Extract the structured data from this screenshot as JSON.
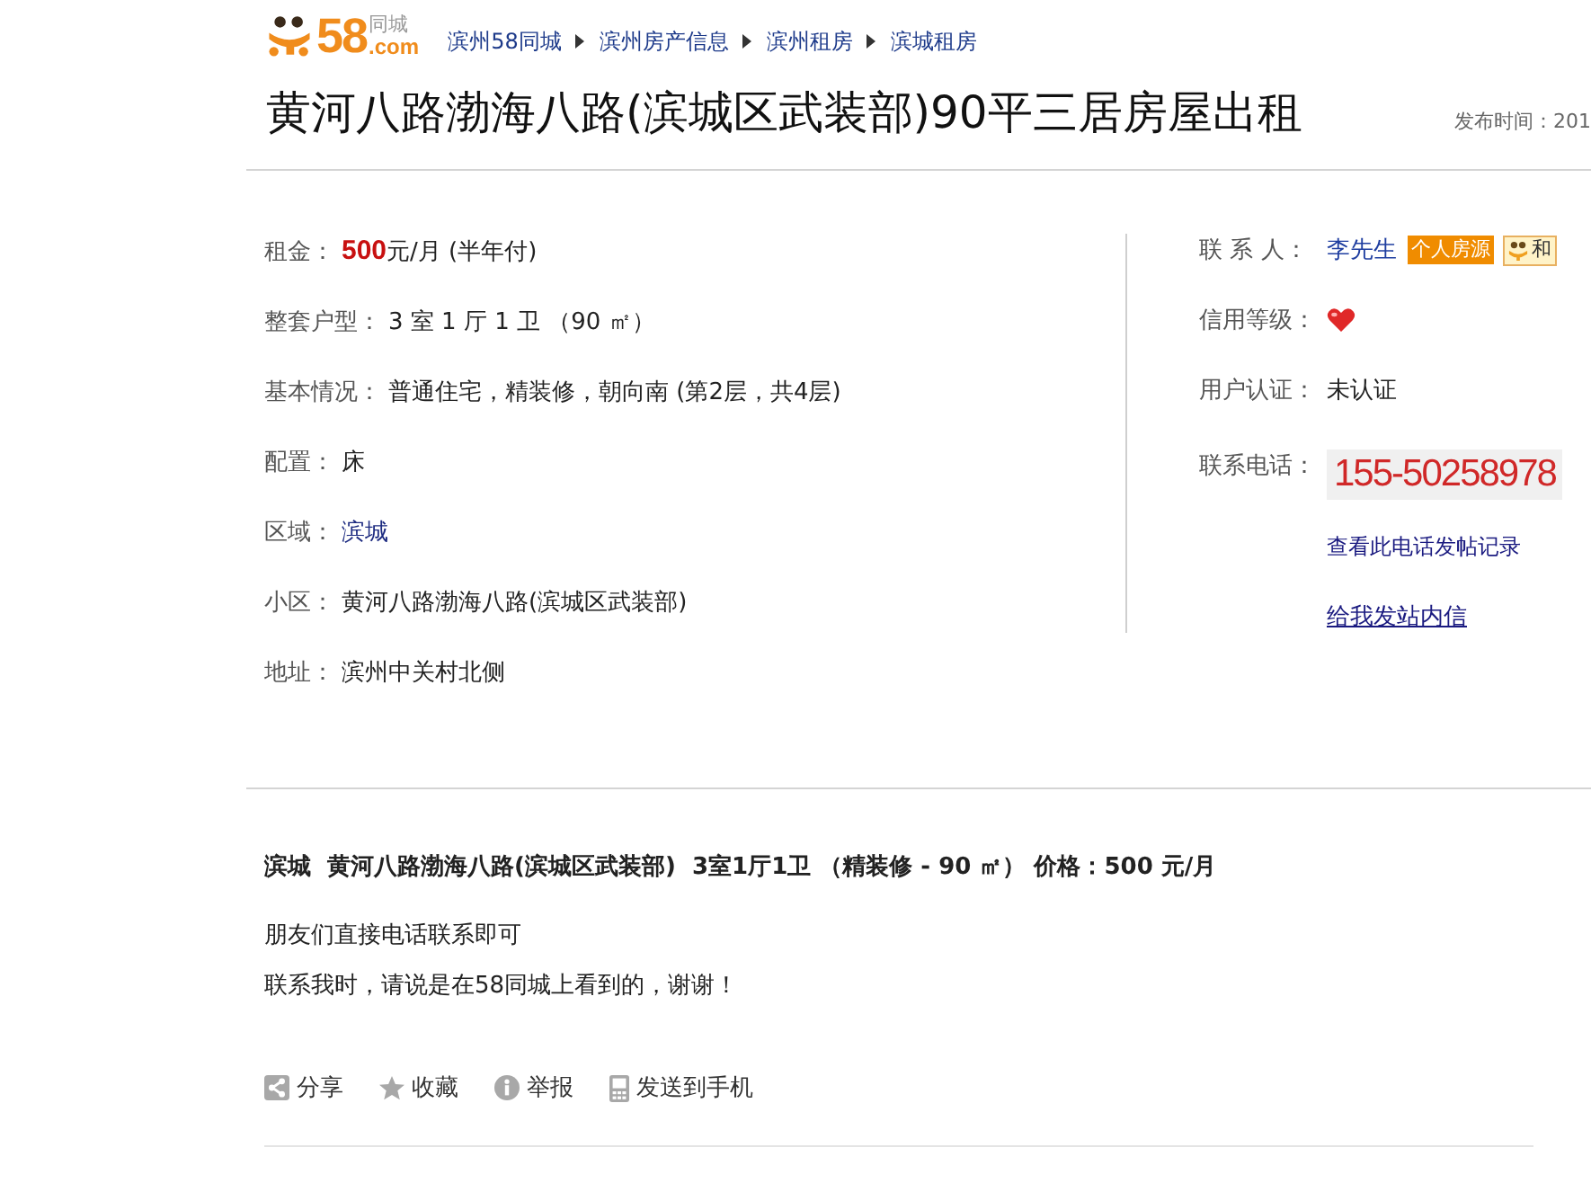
{
  "header": {
    "logo": {
      "number": "58",
      "domain": ".com",
      "city": "同城"
    },
    "breadcrumb": [
      {
        "label": "滨州58同城"
      },
      {
        "label": "滨州房产信息"
      },
      {
        "label": "滨州租房"
      },
      {
        "label": "滨城租房"
      }
    ]
  },
  "listing": {
    "title": "黄河八路渤海八路(滨城区武装部)90平三居房屋出租",
    "publish_time": "发布时间：201"
  },
  "details": [
    {
      "kind": "price",
      "label": "租金：",
      "amount": "500",
      "value": "元/月 (半年付)"
    },
    {
      "kind": "text",
      "label": "整套户型：",
      "value": "3 室 1 厅 1 卫 （90 ㎡）"
    },
    {
      "kind": "text",
      "label": "基本情况：",
      "value": "普通住宅，精装修，朝向南 (第2层，共4层)"
    },
    {
      "kind": "text",
      "label": "配置：",
      "value": "床"
    },
    {
      "kind": "link",
      "label": "区域：",
      "value": "滨城"
    },
    {
      "kind": "text",
      "label": "小区：",
      "value": "黄河八路渤海八路(滨城区武装部)"
    },
    {
      "kind": "text",
      "label": "地址：",
      "value": "滨州中关村北侧"
    }
  ],
  "contact": {
    "person": {
      "label": "联 系 人：",
      "name": "李先生",
      "badges": [
        {
          "kind": "personal",
          "label": "个人房源"
        },
        {
          "kind": "partner",
          "label": "和"
        }
      ]
    },
    "credit": {
      "label": "信用等级："
    },
    "verification": {
      "label": "用户认证：",
      "value": "未认证"
    },
    "phone": {
      "label": "联系电话：",
      "number": "155-50258978"
    },
    "links": [
      {
        "label": "查看此电话发帖记录",
        "underlined": false
      },
      {
        "label": "给我发站内信",
        "underlined": true
      }
    ]
  },
  "summary": "滨城  黄河八路渤海八路(滨城区武装部)  3室1厅1卫 （精装修 - 90 ㎡） 价格：500 元/月",
  "description": [
    "朋友们直接电话联系即可",
    "联系我时，请说是在58同城上看到的，谢谢！"
  ],
  "actions": [
    {
      "kind": "share",
      "label": "分享"
    },
    {
      "kind": "favorite",
      "label": "收藏"
    },
    {
      "kind": "report",
      "label": "举报"
    },
    {
      "kind": "send-to-phone",
      "label": "发送到手机"
    }
  ]
}
